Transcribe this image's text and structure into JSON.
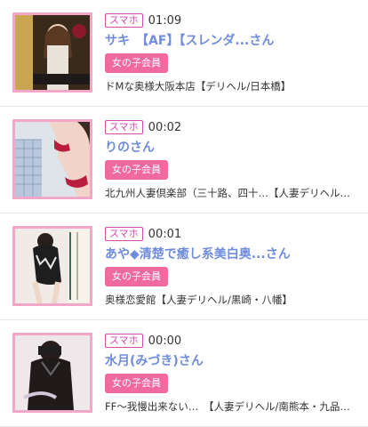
{
  "items": [
    {
      "device_badge": "スマホ",
      "time": "01:09",
      "name": "サキ　【AF】【スレンダ...さん",
      "member_badge": "女の子会員",
      "shop": "ドMな奥様大阪本店【デリヘル/日本橋】",
      "thumb_caption": "サキ",
      "thumb_icon": "photo-woman-icon"
    },
    {
      "device_badge": "スマホ",
      "time": "00:02",
      "name": "りのさん",
      "member_badge": "女の子会員",
      "shop": "北九州人妻倶楽部（三十路、四十…【人妻デリヘル…",
      "thumb_icon": "photo-woman-icon"
    },
    {
      "device_badge": "スマホ",
      "time": "00:01",
      "name": "あや◆清楚で癒し系美白奥...さん",
      "member_badge": "女の子会員",
      "shop": "奥様恋愛館【人妻デリヘル/黒崎・八幡】",
      "thumb_icon": "photo-woman-icon"
    },
    {
      "device_badge": "スマホ",
      "time": "00:00",
      "name": "水月(みづき)さん",
      "member_badge": "女の子会員",
      "shop": "FF〜我慢出来ない…　【人妻デリヘル/南熊本・九品…",
      "thumb_icon": "photo-woman-icon"
    }
  ]
}
